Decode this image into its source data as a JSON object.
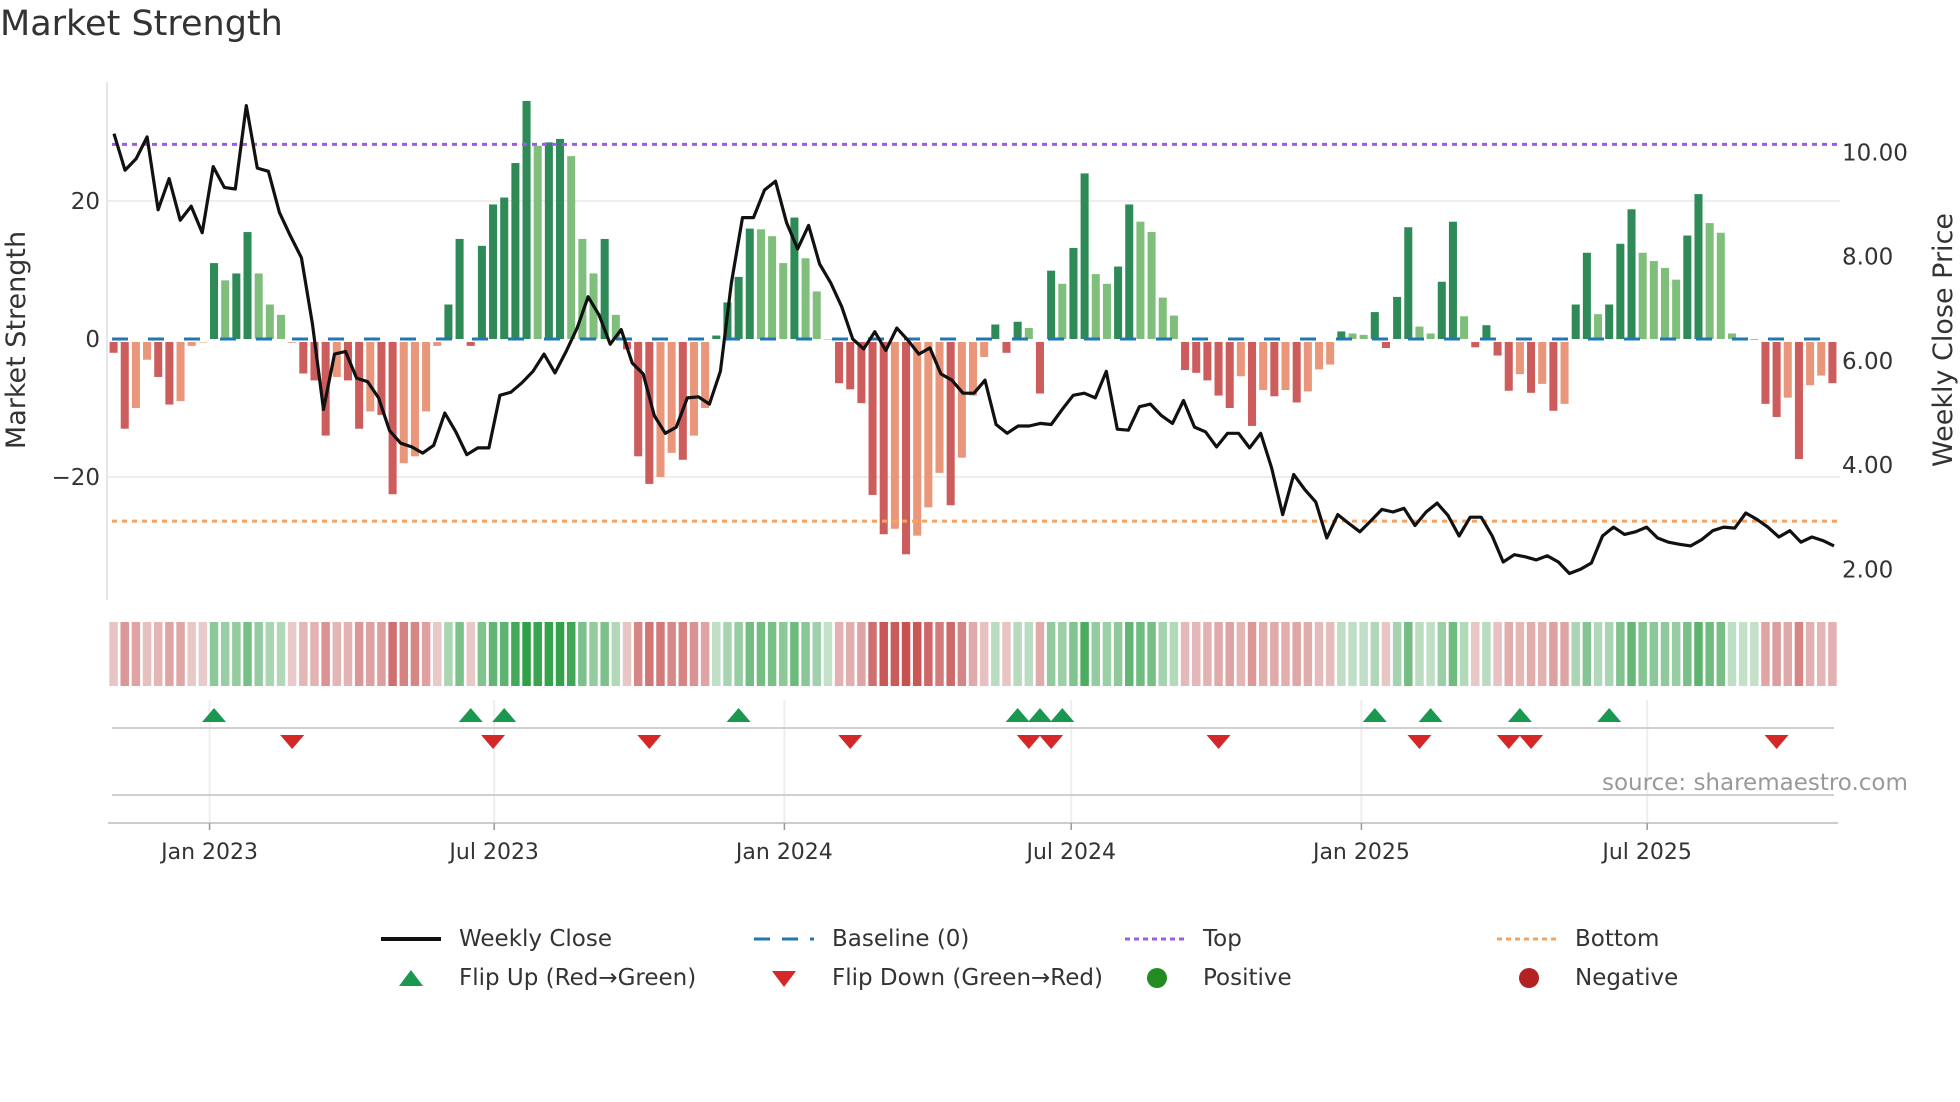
{
  "title": "Market Strength",
  "source": "source: sharemaestro.com",
  "legend": [
    {
      "label": "Weekly Close",
      "icon": "solid-line"
    },
    {
      "label": "Baseline (0)",
      "icon": "dashed-line"
    },
    {
      "label": "Top",
      "icon": "dotted-line"
    },
    {
      "label": "Bottom",
      "icon": "dotted-line"
    },
    {
      "label": "Flip Up (Red→Green)",
      "icon": "triangle-up"
    },
    {
      "label": "Flip Down (Green→Red)",
      "icon": "triangle-down"
    },
    {
      "label": "Positive",
      "icon": "circle"
    },
    {
      "label": "Negative",
      "icon": "circle"
    }
  ],
  "colors": {
    "pos_rising": "#2e8b57",
    "pos_falling": "#7fbf7b",
    "neg_falling": "#cd5c5c",
    "neg_rising": "#e9967a",
    "price": "#111111",
    "baseline": "#1f77b4",
    "top": "#9b5de5",
    "bottom": "#f4a460",
    "flip_up": "#1a9850",
    "flip_down": "#d62728",
    "positive": "#228b22",
    "negative": "#b22222"
  },
  "chart_data": {
    "type": "bar",
    "title": "Market Strength",
    "ylabel": "Market Strength",
    "y2label": "Weekly Close Price",
    "ylim": [
      -38,
      37
    ],
    "y2lim": [
      1.6,
      11.0
    ],
    "yticks": [
      {
        "value": -20,
        "label": "−20"
      },
      {
        "value": 0,
        "label": "0"
      },
      {
        "value": 20,
        "label": "20"
      }
    ],
    "y2ticks": [
      {
        "value": 2,
        "label": "2.00"
      },
      {
        "value": 4,
        "label": "4.00"
      },
      {
        "value": 6,
        "label": "6.00"
      },
      {
        "value": 8,
        "label": "8.00"
      },
      {
        "value": 10,
        "label": "10.00"
      }
    ],
    "xticks": [
      {
        "week": 8.6,
        "label": "Jan 2023"
      },
      {
        "week": 34.1,
        "label": "Jul 2023"
      },
      {
        "week": 60.1,
        "label": "Jan 2024"
      },
      {
        "week": 85.8,
        "label": "Jul 2024"
      },
      {
        "week": 111.8,
        "label": "Jan 2025"
      },
      {
        "week": 137.4,
        "label": "Jul 2025"
      }
    ],
    "top_level": 28.2,
    "bottom_level": -26.4,
    "baseline": 0,
    "strength": [
      -2,
      -13,
      -10,
      -3,
      -5.5,
      -9.5,
      -9,
      -1,
      -0.5,
      11,
      8.5,
      9.5,
      15.5,
      9.5,
      5,
      3.5,
      -0.5,
      -5,
      -6,
      -14,
      -5.5,
      -6,
      -13,
      -10.5,
      -11,
      -22.5,
      -18,
      -17,
      -10.5,
      -1,
      5,
      14.5,
      -1,
      13.5,
      19.5,
      20.5,
      25.5,
      34.5,
      28,
      28.5,
      29,
      26.5,
      14.5,
      9.5,
      14.5,
      3.5,
      -1.5,
      -17,
      -21,
      -20,
      -16.5,
      -17.5,
      -14,
      -10,
      0.5,
      5.3,
      9,
      16,
      15.9,
      14.9,
      11,
      17.6,
      11.7,
      6.9,
      0,
      -6.4,
      -7.3,
      -9.3,
      -22.6,
      -28.3,
      -27.5,
      -31.2,
      -28.5,
      -24.4,
      -19.4,
      -24.1,
      -17.2,
      -8.2,
      -2.6,
      2.1,
      -2,
      2.5,
      1.6,
      -7.9,
      9.9,
      8,
      13.2,
      24,
      9.4,
      8,
      10.5,
      19.5,
      17,
      15.5,
      6,
      3.4,
      -4.5,
      -4.9,
      -6,
      -8.2,
      -10,
      -5.4,
      -12.6,
      -7.4,
      -8.3,
      -7.4,
      -9.2,
      -7.6,
      -4.4,
      -3.7,
      1.1,
      0.8,
      0.6,
      3.9,
      -1.3,
      6.1,
      16.2,
      1.8,
      0.8,
      8.3,
      17,
      3.3,
      -1.2,
      2,
      -2.4,
      -7.5,
      -5.1,
      -7.8,
      -6.5,
      -10.4,
      -9.4,
      5,
      12.5,
      3.6,
      5,
      13.8,
      18.8,
      12.5,
      11.3,
      10.3,
      8.6,
      15,
      21,
      16.8,
      15.4,
      0.8,
      0,
      0,
      -9.4,
      -11.3,
      -8.5,
      -17.4,
      -6.7,
      -5.3,
      -6.4
    ],
    "weekly_close": [
      10.36,
      9.66,
      9.88,
      10.3,
      8.9,
      9.5,
      8.7,
      8.97,
      8.46,
      9.73,
      9.33,
      9.3,
      10.9,
      9.7,
      9.64,
      8.85,
      8.4,
      7.98,
      6.7,
      5.07,
      6.13,
      6.18,
      5.67,
      5.6,
      5.29,
      4.66,
      4.42,
      4.35,
      4.23,
      4.38,
      5.0,
      4.64,
      4.2,
      4.33,
      4.33,
      5.34,
      5.4,
      5.58,
      5.8,
      6.13,
      5.77,
      6.18,
      6.63,
      7.23,
      6.88,
      6.32,
      6.6,
      5.96,
      5.75,
      4.95,
      4.61,
      4.73,
      5.29,
      5.31,
      5.17,
      5.8,
      7.5,
      8.75,
      8.75,
      9.28,
      9.45,
      8.65,
      8.15,
      8.6,
      7.86,
      7.5,
      7.04,
      6.42,
      6.23,
      6.56,
      6.2,
      6.63,
      6.4,
      6.13,
      6.25,
      5.75,
      5.63,
      5.38,
      5.38,
      5.63,
      4.78,
      4.61,
      4.75,
      4.75,
      4.8,
      4.78,
      5.07,
      5.34,
      5.38,
      5.29,
      5.8,
      4.69,
      4.67,
      5.12,
      5.17,
      4.95,
      4.8,
      5.24,
      4.73,
      4.64,
      4.35,
      4.61,
      4.61,
      4.33,
      4.61,
      3.94,
      3.05,
      3.82,
      3.53,
      3.29,
      2.6,
      3.05,
      2.88,
      2.72,
      2.93,
      3.15,
      3.1,
      3.17,
      2.84,
      3.1,
      3.27,
      3.03,
      2.64,
      3.0,
      3.0,
      2.64,
      2.14,
      2.28,
      2.24,
      2.18,
      2.26,
      2.14,
      1.92,
      2.0,
      2.12,
      2.64,
      2.81,
      2.67,
      2.72,
      2.81,
      2.6,
      2.52,
      2.48,
      2.45,
      2.57,
      2.74,
      2.81,
      2.79,
      3.08,
      2.96,
      2.81,
      2.62,
      2.74,
      2.52,
      2.62,
      2.55,
      2.45
    ],
    "flip_up_weeks": [
      9,
      32,
      35,
      56,
      81,
      83,
      85,
      113,
      118,
      126,
      134
    ],
    "flip_down_weeks": [
      16,
      34,
      48,
      66,
      82,
      84,
      99,
      117,
      125,
      127,
      149
    ]
  }
}
